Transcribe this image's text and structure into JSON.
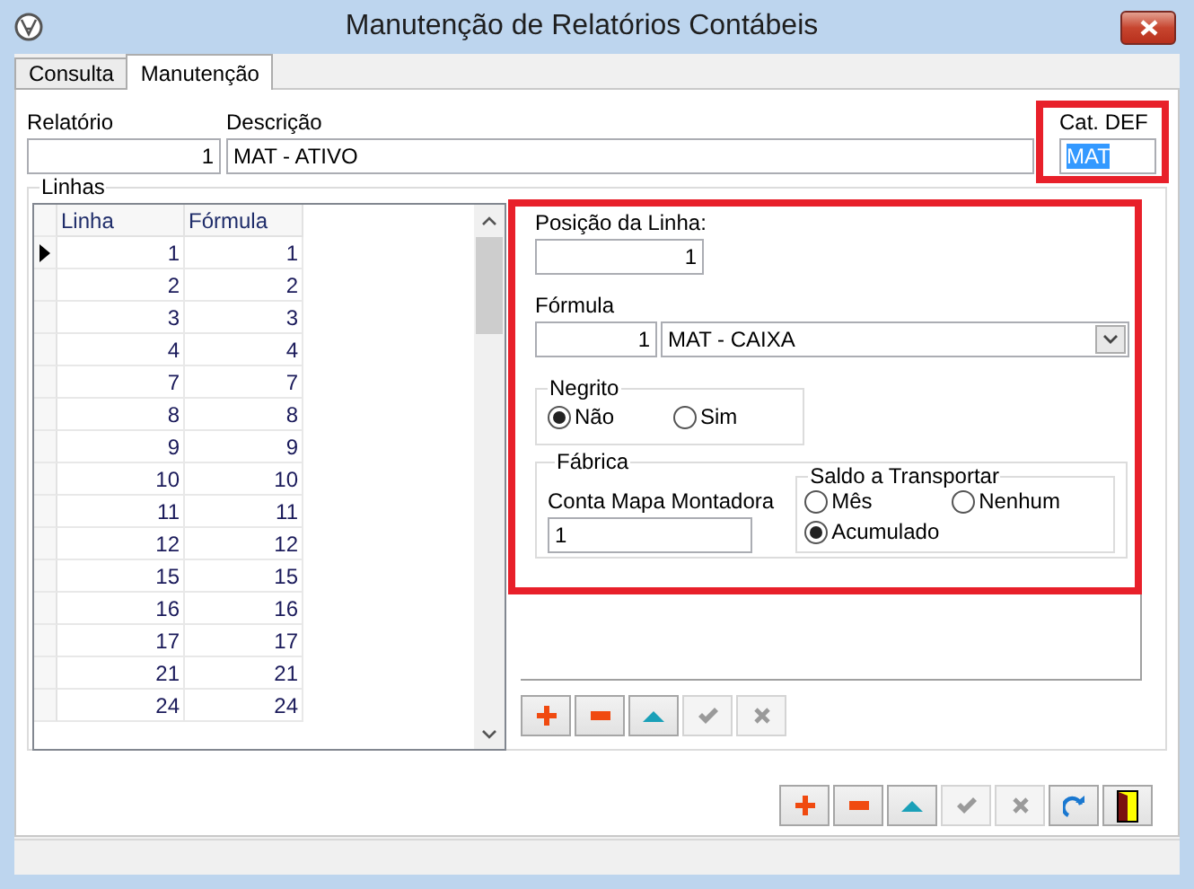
{
  "window": {
    "title": "Manutenção de Relatórios Contábeis"
  },
  "tabs": [
    {
      "label": "Consulta",
      "selected": false
    },
    {
      "label": "Manutenção",
      "selected": true
    }
  ],
  "header": {
    "relatorio_label": "Relatório",
    "relatorio": "1",
    "descricao_label": "Descrição",
    "descricao": "MAT - ATIVO",
    "cat_label": "Cat. DEF",
    "cat": "MAT"
  },
  "linhas": {
    "title": "Linhas",
    "columns": [
      "Linha",
      "Fórmula"
    ],
    "rows": [
      {
        "linha": "1",
        "formula": "1",
        "selected": true
      },
      {
        "linha": "2",
        "formula": "2",
        "selected": false
      },
      {
        "linha": "3",
        "formula": "3",
        "selected": false
      },
      {
        "linha": "4",
        "formula": "4",
        "selected": false
      },
      {
        "linha": "7",
        "formula": "7",
        "selected": false
      },
      {
        "linha": "8",
        "formula": "8",
        "selected": false
      },
      {
        "linha": "9",
        "formula": "9",
        "selected": false
      },
      {
        "linha": "10",
        "formula": "10",
        "selected": false
      },
      {
        "linha": "11",
        "formula": "11",
        "selected": false
      },
      {
        "linha": "12",
        "formula": "12",
        "selected": false
      },
      {
        "linha": "15",
        "formula": "15",
        "selected": false
      },
      {
        "linha": "16",
        "formula": "16",
        "selected": false
      },
      {
        "linha": "17",
        "formula": "17",
        "selected": false
      },
      {
        "linha": "21",
        "formula": "21",
        "selected": false
      },
      {
        "linha": "24",
        "formula": "24",
        "selected": false
      }
    ]
  },
  "details": {
    "posicao_label": "Posição da Linha:",
    "posicao": "1",
    "formula_label": "Fórmula",
    "formula_num": "1",
    "formula_name": "MAT - CAIXA",
    "negrito": {
      "title": "Negrito",
      "options": [
        {
          "label": "Não",
          "selected": true
        },
        {
          "label": "Sim",
          "selected": false
        }
      ]
    },
    "fabrica": {
      "title": "Fábrica",
      "conta_label": "Conta Mapa Montadora",
      "conta": "1",
      "saldo": {
        "title": "Saldo a Transportar",
        "options": [
          {
            "label": "Mês",
            "selected": false
          },
          {
            "label": "Nenhum",
            "selected": false
          },
          {
            "label": "Acumulado",
            "selected": true
          }
        ]
      }
    }
  },
  "detail_buttons": [
    {
      "kind": "add",
      "disabled": false
    },
    {
      "kind": "remove",
      "disabled": false
    },
    {
      "kind": "up",
      "disabled": false
    },
    {
      "kind": "confirm",
      "disabled": true
    },
    {
      "kind": "cancel",
      "disabled": true
    }
  ],
  "main_buttons": [
    {
      "kind": "add",
      "disabled": false
    },
    {
      "kind": "remove",
      "disabled": false
    },
    {
      "kind": "up",
      "disabled": false
    },
    {
      "kind": "confirm",
      "disabled": true
    },
    {
      "kind": "cancel",
      "disabled": true
    },
    {
      "kind": "refresh",
      "disabled": false
    },
    {
      "kind": "exit",
      "disabled": false
    }
  ]
}
